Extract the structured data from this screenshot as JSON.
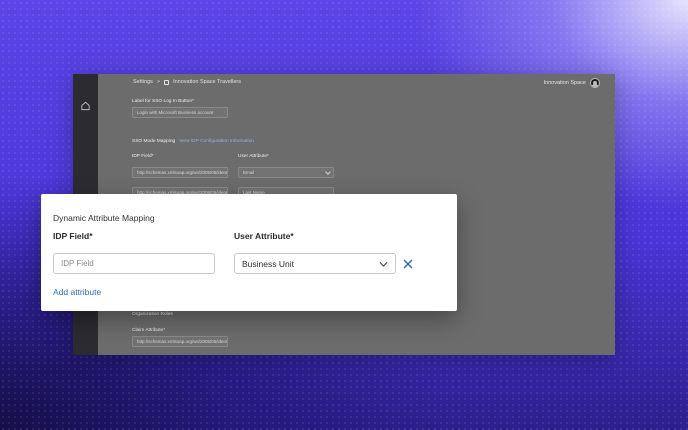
{
  "background_app": {
    "breadcrumb": {
      "root": "Settings",
      "separator": ">",
      "current": "Innovation Space Travellers"
    },
    "user": {
      "name": "Innovation Space"
    },
    "label_field": {
      "label": "Label for SSO Log In Button*",
      "value": "Login with Microsoft Business account"
    },
    "mapping": {
      "title": "SSO Mode Mapping",
      "link": "View IDP Configuration Information",
      "idp_label": "IDP Field*",
      "attr_label": "User Attribute*",
      "row1_idp": "http://schemas.xmlsoap.org/ws/2005/05/identity",
      "row1_attr": "Email",
      "row2_idp": "http://schemas.xmlsoap.org/ws/2005/05/identity",
      "row2_attr": "Last Name"
    },
    "org_field": {
      "title": "Organization Roles",
      "label": "Claim Attribute*",
      "value": "http://schemas.xmlsoap.org/ws/2005/05/identity"
    }
  },
  "dialog": {
    "title": "Dynamic Attribute Mapping",
    "idp_field_label": "IDP Field*",
    "idp_field_placeholder": "IDP Field",
    "idp_field_value": "",
    "user_attribute_label": "User Attribute*",
    "user_attribute_value": "Business Unit",
    "add_attribute_label": "Add attribute"
  },
  "colors": {
    "link": "#2a6fb5",
    "remove_icon": "#2a6fb5",
    "background_primary": "#4a35d8"
  },
  "icons": {
    "sidebar_home": "home-icon",
    "space": "space-icon",
    "select_chevron": "chevron-down-icon",
    "remove": "close-icon"
  }
}
